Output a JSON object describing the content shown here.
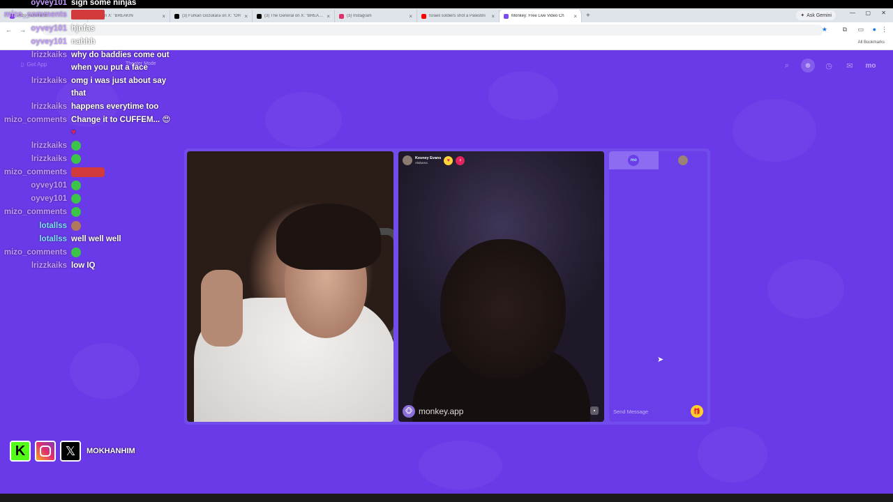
{
  "browser": {
    "tabs": [
      {
        "title": "mizo_comments",
        "icon": "twitch-icon",
        "color": "#9146ff"
      },
      {
        "title": "r on X: \"BREAKIN",
        "icon": "x-icon",
        "color": "#000000"
      },
      {
        "title": "(3) Furkan Gözükara on X: \"OH",
        "icon": "x-icon",
        "color": "#000000"
      },
      {
        "title": "(3) The General on X: \"BREAKIN",
        "icon": "x-icon",
        "color": "#000000"
      },
      {
        "title": "(3) Instagram",
        "icon": "instagram-icon",
        "color": "#e1306c"
      },
      {
        "title": "Israeli soldiers shot a Palestini",
        "icon": "youtube-icon",
        "color": "#ff0000"
      },
      {
        "title": "Monkey: Free Live Video Ch",
        "icon": "monkey-icon",
        "color": "#7a4cf0"
      }
    ],
    "new_tab": "+",
    "ask_gemini": "Ask Gemini",
    "all_bookmarks": "All Bookmarks"
  },
  "page": {
    "get_app": "Get App",
    "theater_mode": "Theater Mode",
    "nav_mo": "mo"
  },
  "chat": [
    {
      "user": "oyvey101",
      "text": "sign some ninjas",
      "color": "#c39bff"
    },
    {
      "user": "mizo_comments",
      "text": "",
      "color": "#c39bff"
    },
    {
      "user": "oyvey101",
      "text": "hjnfas",
      "color": "#c39bff"
    },
    {
      "user": "oyvey101",
      "text": "nahhh",
      "color": "#c39bff"
    },
    {
      "user": "lrizzkaiks",
      "text": "why do baddies come out when you put a face",
      "color": "#c39bff"
    },
    {
      "user": "lrizzkaiks",
      "text": "omg i was just about say that",
      "color": "#c39bff"
    },
    {
      "user": "lrizzkaiks",
      "text": "happens everytime too",
      "color": "#c39bff"
    },
    {
      "user": "mizo_comments",
      "text": "Change it to CUFFEM...",
      "color": "#c39bff"
    },
    {
      "user": "lrizzkaiks",
      "text": "",
      "color": "#c39bff"
    },
    {
      "user": "lrizzkaiks",
      "text": "",
      "color": "#c39bff"
    },
    {
      "user": "mizo_comments",
      "text": "",
      "color": "#c39bff"
    },
    {
      "user": "oyvey101",
      "text": "",
      "color": "#c39bff"
    },
    {
      "user": "oyvey101",
      "text": "",
      "color": "#c39bff"
    },
    {
      "user": "mizo_comments",
      "text": "",
      "color": "#c39bff"
    },
    {
      "user": "lotallss",
      "text": "",
      "color": "#7fe0ff"
    },
    {
      "user": "lotallss",
      "text": "well well well",
      "color": "#7fe0ff"
    },
    {
      "user": "mizo_comments",
      "text": "",
      "color": "#c39bff"
    },
    {
      "user": "lrizzkaiks",
      "text": "low IQ",
      "color": "#c39bff"
    }
  ],
  "peer": {
    "name": "Kesney Evans",
    "location": "Alabama"
  },
  "watermark": "monkey.app",
  "chat_panel": {
    "tab_mo": "mo",
    "send_placeholder": "Send Message"
  },
  "socials": {
    "handle": "MOKHANHIM"
  }
}
